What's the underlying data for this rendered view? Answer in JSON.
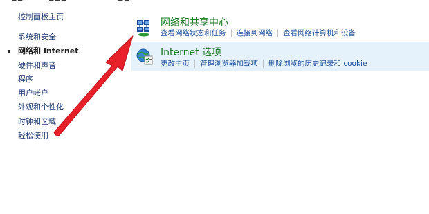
{
  "sidebar": {
    "home": "控制面板主页",
    "items": [
      {
        "label": "系统和安全",
        "active": false
      },
      {
        "label": "网络和 Internet",
        "active": true
      },
      {
        "label": "硬件和声音",
        "active": false
      },
      {
        "label": "程序",
        "active": false
      },
      {
        "label": "用户帐户",
        "active": false
      },
      {
        "label": "外观和个性化",
        "active": false
      },
      {
        "label": "时钟和区域",
        "active": false
      },
      {
        "label": "轻松使用",
        "active": false
      }
    ]
  },
  "main": {
    "categories": [
      {
        "title": "网络和共享中心",
        "icon": "network-sharing-center-icon",
        "links": [
          "查看网络状态和任务",
          "连接到网络",
          "查看网络计算机和设备"
        ]
      },
      {
        "title": "Internet 选项",
        "icon": "internet-options-icon",
        "highlighted": true,
        "links": [
          "更改主页",
          "管理浏览器加载项",
          "删除浏览的历史记录和 cookie"
        ]
      }
    ]
  },
  "annotation": {
    "color": "#e8202a",
    "icon": "red-arrow-annotation"
  }
}
